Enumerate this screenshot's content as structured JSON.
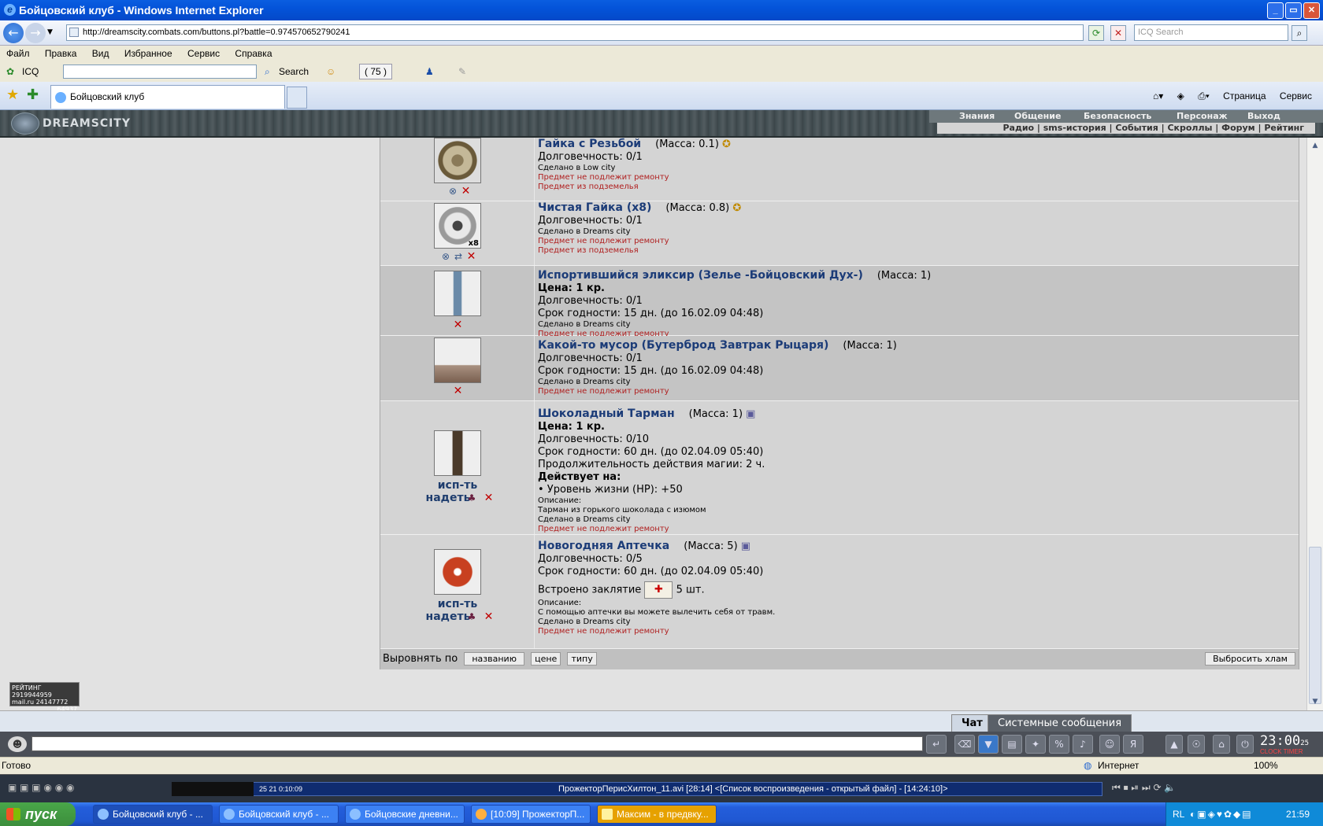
{
  "window": {
    "title": "Бойцовский клуб - Windows Internet Explorer"
  },
  "address": {
    "url": "http://dreamscity.combats.com/buttons.pl?battle=0.974570652790241",
    "search_placeholder": "ICQ Search"
  },
  "menu": [
    "Файл",
    "Правка",
    "Вид",
    "Избранное",
    "Сервис",
    "Справка"
  ],
  "icqbar": {
    "icq_label": "ICQ",
    "search_label": "Search",
    "counter": "( 75 )"
  },
  "tab": {
    "label": "Бойцовский клуб"
  },
  "commandbar": {
    "page": "Страница",
    "tools": "Сервис"
  },
  "game": {
    "logo": "DREAMSCITY",
    "topnav": [
      "Знания",
      "Общение",
      "Безопасность",
      "Персонаж",
      "Выход"
    ],
    "subnav": "Радио | sms-история | События | Скроллы | Форум | Рейтинг"
  },
  "items": [
    {
      "name": "Гайка с Резьбой",
      "mass": "(Масса: 0.1)",
      "lines": [
        "Долговечность: 0/1"
      ],
      "made": "Сделано в Low city",
      "red": [
        "Предмет не подлежит ремонту",
        "Предмет из подземелья"
      ]
    },
    {
      "name": "Чистая Гайка (x8)",
      "mass": "(Масса: 0.8)",
      "count": "x8",
      "lines": [
        "Долговечность: 0/1"
      ],
      "made": "Сделано в Dreams city",
      "red": [
        "Предмет не подлежит ремонту",
        "Предмет из подземелья"
      ]
    },
    {
      "name": "Испортившийся эликсир (Зелье -Бойцовский Дух-)",
      "mass": "(Масса: 1)",
      "price": "Цена: 1 кр.",
      "lines": [
        "Долговечность: 0/1",
        "Срок годности: 15 дн. (до 16.02.09 04:48)"
      ],
      "made": "Сделано в Dreams city",
      "red": [
        "Предмет не подлежит ремонту"
      ]
    },
    {
      "name": "Какой-то мусор (Бутерброд Завтрак Рыцаря)",
      "mass": "(Масса: 1)",
      "lines": [
        "Долговечность: 0/1",
        "Срок годности: 15 дн. (до 16.02.09 04:48)"
      ],
      "made": "Сделано в Dreams city",
      "red": [
        "Предмет не подлежит ремонту"
      ]
    },
    {
      "name": "Шоколадный Тарман",
      "mass": "(Масса: 1)",
      "price": "Цена: 1 кр.",
      "lines": [
        "Долговечность: 0/10",
        "Срок годности: 60 дн. (до 02.04.09 05:40)",
        "Продолжительность действия магии: 2 ч."
      ],
      "effect_title": "Действует на:",
      "effect": "• Уровень жизни (HP): +50",
      "desc_title": "Описание:",
      "desc": "Тарман из горького шоколада с изюмом",
      "made": "Сделано в Dreams city",
      "red": [
        "Предмет не подлежит ремонту"
      ],
      "use": "исп-ть",
      "wear": "надеть"
    },
    {
      "name": "Новогодняя Аптечка",
      "mass": "(Масса: 5)",
      "lines": [
        "Долговечность: 0/5",
        "Срок годности: 60 дн. (до 02.04.09 05:40)"
      ],
      "spell_label": "Встроено заклятие",
      "spell_count": "5 шт.",
      "desc_title": "Описание:",
      "desc": "С помощью аптечки вы можете вылечить себя от травм.",
      "made": "Сделано в Dreams city",
      "red": [
        "Предмет не подлежит ремонту"
      ],
      "use": "исп-ть",
      "wear": "надеть"
    }
  ],
  "sortbar": {
    "label": "Выровнять по",
    "by_name": "названию",
    "by_price": "цене",
    "by_type": "типу",
    "discard": "Выбросить хлам"
  },
  "rating": {
    "l1": "РЕЙТИНГ 2919944959",
    "l2": "mail.ru 24147772",
    "l3": "64937"
  },
  "chat": {
    "tab_chat": "Чат",
    "tab_system": "Системные сообщения",
    "time": "23:00",
    "seconds": "25",
    "clock_label": "CLOCK TIMER"
  },
  "status": {
    "ready": "Готово",
    "zone": "Интернет",
    "zoom": "100%"
  },
  "media": {
    "track": "ПрожекторПерисХилтон_11.avi  [28:14]   <[Список воспроизведения - открытый файл] - [14:24:10]>",
    "pos": "25    21    0:10:09"
  },
  "taskbar": {
    "start": "пуск",
    "tasks": [
      "Бойцовский клуб - ...",
      "Бойцовский клуб - ...",
      "Бойцовские дневни...",
      "[10:09] ПрожекторП...",
      "Максим - в предвку..."
    ],
    "lang": "RL",
    "time": "21:59"
  }
}
